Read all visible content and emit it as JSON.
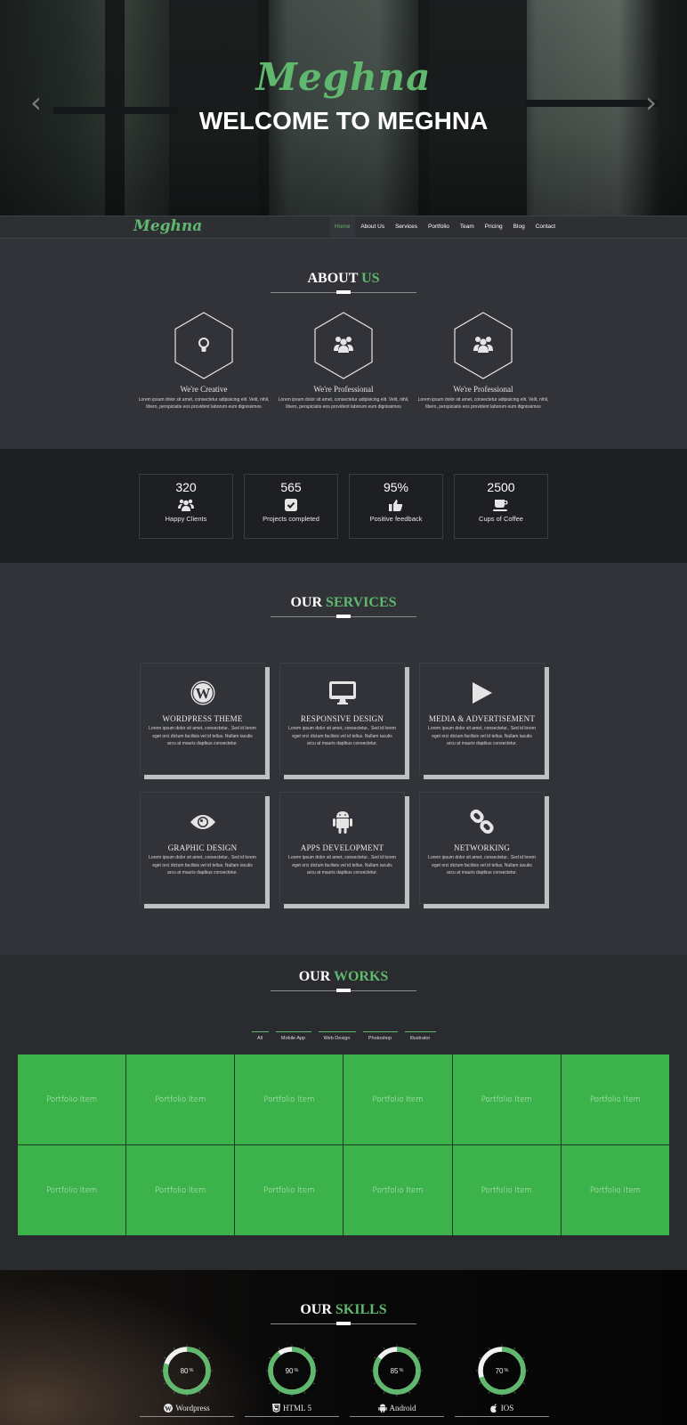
{
  "hero": {
    "script_logo": "Meghna",
    "headline": "WELCOME TO MEGHNA",
    "prev_icon": "chevron-left-icon",
    "next_icon": "chevron-right-icon"
  },
  "nav": {
    "logo": "Meghna",
    "items": [
      {
        "label": "Home",
        "active": true
      },
      {
        "label": "About Us"
      },
      {
        "label": "Services"
      },
      {
        "label": "Portfolio"
      },
      {
        "label": "Team"
      },
      {
        "label": "Pricing"
      },
      {
        "label": "Blog"
      },
      {
        "label": "Contact"
      }
    ]
  },
  "about": {
    "title_white": "ABOUT",
    "title_green": "US",
    "cols": [
      {
        "icon": "lightbulb-icon",
        "title": "We're Creative",
        "text": "Lorem ipsum dolor sit amet, consectetur adipisicing elit. Velit, nihil, libero, perspiciatis eos provident laborum eum dignissimos"
      },
      {
        "icon": "users-icon",
        "title": "We're Professional",
        "text": "Lorem ipsum dolor sit amet, consectetur adipisicing elit. Velit, nihil, libero, perspiciatis eos provident laborum eum dignissimos"
      },
      {
        "icon": "users-icon",
        "title": "We're Professional",
        "text": "Lorem ipsum dolor sit amet, consectetur adipisicing elit. Velit, nihil, libero, perspiciatis eos provident laborum eum dignissimos"
      }
    ]
  },
  "counters": [
    {
      "value": "320",
      "icon": "users-icon",
      "label": "Happy Clients"
    },
    {
      "value": "565",
      "icon": "checkbox-icon",
      "label": "Projects completed"
    },
    {
      "value": "95%",
      "icon": "thumbs-up-icon",
      "label": "Positive feedback"
    },
    {
      "value": "2500",
      "icon": "coffee-cup-icon",
      "label": "Cups of Coffee"
    }
  ],
  "services": {
    "title_white": "OUR",
    "title_green": "SERVICES",
    "items": [
      {
        "icon": "wordpress-icon",
        "title": "WORDPRESS THEME",
        "text": "Lorem ipsum dolor sit amet, consectetur.. Sed id lorem eget orci dictum facilisis vel id tellus. Nullam iaculis arcu at mauris dapibus consectetur."
      },
      {
        "icon": "desktop-icon",
        "title": "RESPONSIVE DESIGN",
        "text": "Lorem ipsum dolor sit amet, consectetur.. Sed id lorem eget orci dictum facilisis vel id tellus. Nullam iaculis arcu at mauris dapibus consectetur."
      },
      {
        "icon": "play-icon",
        "title": "MEDIA & ADVERTISEMENT",
        "text": "Lorem ipsum dolor sit amet, consectetur.. Sed id lorem eget orci dictum facilisis vel id tellus. Nullam iaculis arcu at mauris dapibus consectetur."
      },
      {
        "icon": "eye-icon",
        "title": "GRAPHIC DESIGN",
        "text": "Lorem ipsum dolor sit amet, consectetur.. Sed id lorem eget orci dictum facilisis vel id tellus. Nullam iaculis arcu at mauris dapibus consectetur."
      },
      {
        "icon": "android-icon",
        "title": "APPS DEVELOPMENT",
        "text": "Lorem ipsum dolor sit amet, consectetur.. Sed id lorem eget orci dictum facilisis vel id tellus. Nullam iaculis arcu at mauris dapibus consectetur."
      },
      {
        "icon": "link-icon",
        "title": "NETWORKING",
        "text": "Lorem ipsum dolor sit amet, consectetur.. Sed id lorem eget orci dictum facilisis vel id tellus. Nullam iaculis arcu at mauris dapibus consectetur."
      }
    ]
  },
  "works": {
    "title_white": "OUR",
    "title_green": "WORKS",
    "filters": [
      "All",
      "Mobile App",
      "Web Design",
      "Photoshop",
      "Illustrator"
    ],
    "items": [
      "Portfolio Item",
      "Portfolio Item",
      "Portfolio Item",
      "Portfolio Item",
      "Portfolio Item",
      "Portfolio Item",
      "Portfolio Item",
      "Portfolio Item",
      "Portfolio Item",
      "Portfolio Item",
      "Portfolio Item",
      "Portfolio Item"
    ]
  },
  "skills": {
    "title_white": "OUR",
    "title_green": "SKILLS",
    "items": [
      {
        "percent": 80,
        "label": "80",
        "unit": "%",
        "icon": "wordpress-icon",
        "name": "Wordpress"
      },
      {
        "percent": 90,
        "label": "90",
        "unit": "%",
        "icon": "html5-icon",
        "name": "HTML 5"
      },
      {
        "percent": 85,
        "label": "85",
        "unit": "%",
        "icon": "android-icon",
        "name": "Android"
      },
      {
        "percent": 70,
        "label": "70",
        "unit": "%",
        "icon": "apple-icon",
        "name": "IOS"
      }
    ]
  },
  "colors": {
    "accent": "#5fb86e",
    "portfolio_green": "#3bb24a",
    "dark_bg": "#323338",
    "counter_bg": "#1e1f23"
  }
}
